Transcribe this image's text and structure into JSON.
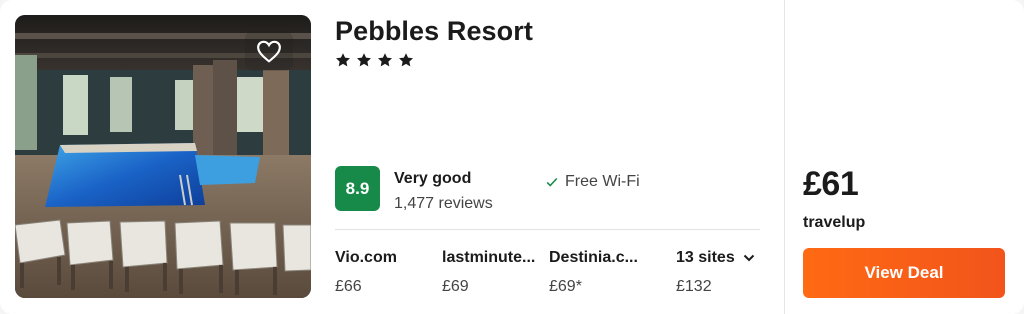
{
  "hotel": {
    "name": "Pebbles Resort",
    "star_count": 4,
    "photo_alt": "Indoor pool",
    "favorite_icon": "heart-outline-icon"
  },
  "rating": {
    "score": "8.9",
    "label": "Very good",
    "reviews": "1,477 reviews",
    "badge_color": "#178a4a"
  },
  "amenities": [
    {
      "icon": "check-icon",
      "label": "Free Wi-Fi"
    }
  ],
  "providers": [
    {
      "name": "Vio.com",
      "price": "£66"
    },
    {
      "name": "lastminute...",
      "price": "£69"
    },
    {
      "name": "Destinia.c...",
      "price": "£69*"
    }
  ],
  "more_sites": {
    "label": "13 sites",
    "price": "£132",
    "icon": "chevron-down-icon"
  },
  "deal": {
    "price": "£61",
    "provider": "travelup",
    "button_label": "View Deal",
    "button_color": "#f85e16"
  }
}
